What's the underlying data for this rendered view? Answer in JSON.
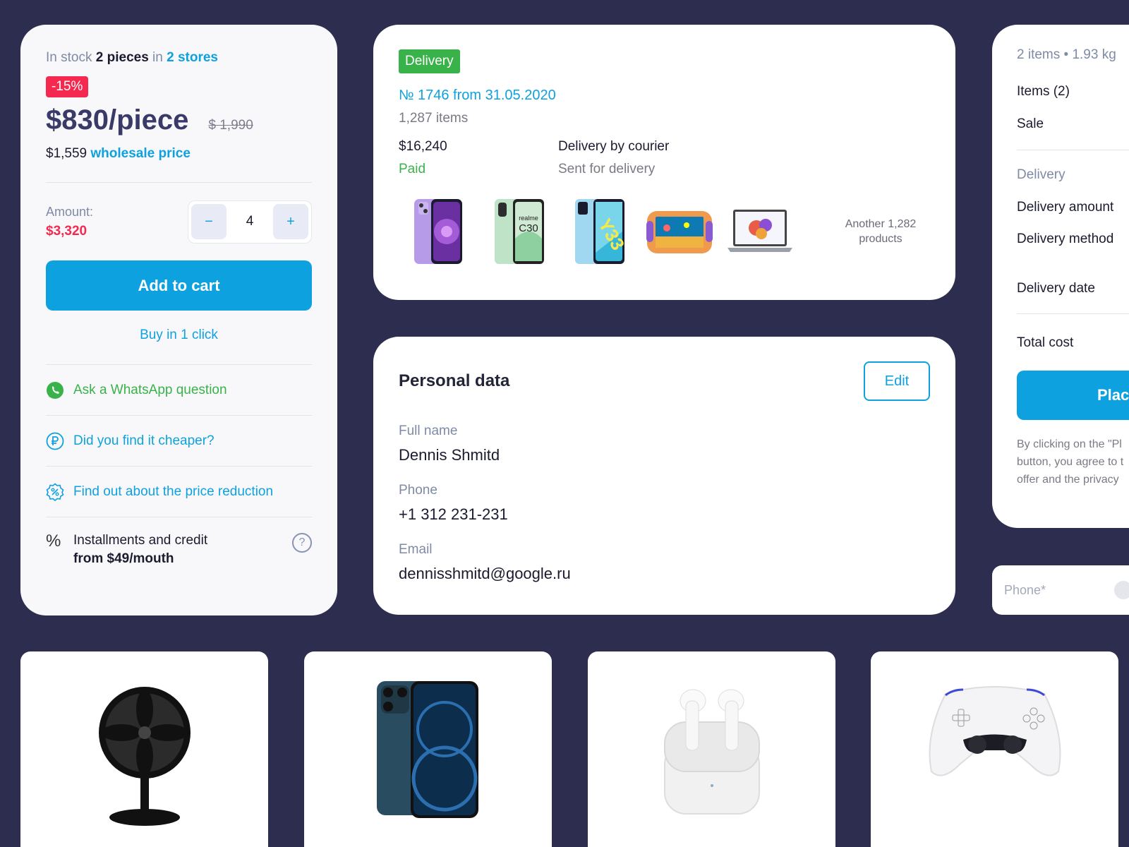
{
  "product": {
    "stock_prefix": "In stock",
    "stock_qty": "2 pieces",
    "stock_in": "in",
    "stock_stores": "2 stores",
    "discount": "-15%",
    "price": "$830/piece",
    "old_price": "$ 1,990",
    "wholesale_value": "$1,559",
    "wholesale_label": "wholesale price",
    "amount_label": "Amount:",
    "amount_value": "$3,320",
    "minus": "−",
    "qty": "4",
    "plus": "+",
    "add_to_cart": "Add to cart",
    "buy_one_click": "Buy in 1 click",
    "whatsapp": "Ask a WhatsApp question",
    "cheaper": "Did you find it cheaper?",
    "price_reduction": "Find out about the price reduction",
    "installments_line1": "Installments and credit",
    "installments_line2": "from $49/mouth",
    "percent_symbol": "%",
    "help_symbol": "?",
    "colors": {
      "accent": "#0ea1e0",
      "sale": "#f5294f",
      "whatsapp": "#3ab24a"
    }
  },
  "delivery": {
    "badge": "Delivery",
    "order": "№ 1746 from 31.05.2020",
    "items": "1,287 items",
    "total": "$16,240",
    "status": "Paid",
    "method": "Delivery by courier",
    "method_status": "Sent for delivery",
    "products": [
      "purple-phone",
      "green-phone",
      "blue-phone",
      "kids-tablet",
      "laptop"
    ],
    "thumb_labels": {
      "realme": "realme",
      "c30": "C30",
      "y33": "Y33"
    },
    "another_line1": "Another 1,282",
    "another_line2": "products"
  },
  "personal": {
    "title": "Personal data",
    "edit": "Edit",
    "name_label": "Full name",
    "name": "Dennis Shmitd",
    "phone_label": "Phone",
    "phone": "+1 312 231-231",
    "email_label": "Email",
    "email": "dennisshmitd@google.ru"
  },
  "summary": {
    "top": "2 items • 1.93 kg",
    "items": "Items (2)",
    "sale": "Sale",
    "delivery": "Delivery",
    "delivery_amount": "Delivery amount",
    "delivery_method": "Delivery method",
    "delivery_date": "Delivery date",
    "total": "Total cost",
    "button": "Plac",
    "agree_1": "By clicking on the \"Pl",
    "agree_2": "button, you agree to t",
    "agree_3": "offer and the privacy"
  },
  "phone_input": {
    "placeholder": "Phone*"
  },
  "tiles": [
    "desk-fan",
    "iphone",
    "airpods",
    "gamepad"
  ]
}
